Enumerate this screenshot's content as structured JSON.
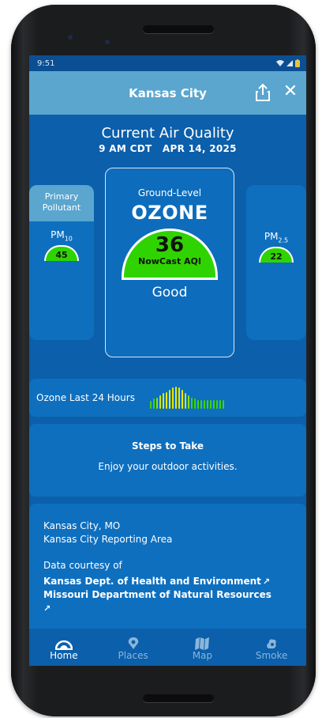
{
  "status": {
    "time": "9:51"
  },
  "appbar": {
    "title": "Kansas City"
  },
  "current": {
    "title": "Current Air Quality",
    "datetime": "9 AM CDT   APR 14, 2025"
  },
  "primary": {
    "header": "Primary Pollutant",
    "pollutant_main": "PM",
    "pollutant_sub": "10",
    "value": "45"
  },
  "main": {
    "label": "Ground-Level",
    "pollutant": "OZONE",
    "value": "36",
    "value_label": "NowCast AQI",
    "category": "Good",
    "color": "#2fd400"
  },
  "secondary": {
    "pollutant_main": "PM",
    "pollutant_sub": "2.5",
    "value": "22"
  },
  "trend": {
    "label": "Ozone Last 24 Hours",
    "levels": [
      0.35,
      0.45,
      0.5,
      0.6,
      0.7,
      0.75,
      0.85,
      0.95,
      1.0,
      0.95,
      0.85,
      0.7,
      0.6,
      0.5,
      0.45,
      0.4,
      0.4,
      0.4,
      0.4,
      0.4,
      0.4,
      0.4,
      0.4,
      0.4
    ],
    "colors": [
      "#3fd400",
      "#3fd400",
      "#8ee000",
      "#cbe800",
      "#e0e800",
      "#e8e800",
      "#e8e800",
      "#e8e800",
      "#e8e800",
      "#e8e800",
      "#e8e800",
      "#cbe800",
      "#8ee000",
      "#3fd400",
      "#3fd400",
      "#3fd400",
      "#3fd400",
      "#3fd400",
      "#3fd400",
      "#3fd400",
      "#3fd400",
      "#3fd400",
      "#3fd400",
      "#3fd400"
    ]
  },
  "steps": {
    "title": "Steps to Take",
    "text": "Enjoy your outdoor activities."
  },
  "info": {
    "location": "Kansas City, MO",
    "area": "Kansas City Reporting Area",
    "courtesy": "Data courtesy of",
    "source1": "Kansas Dept. of Health and Environment",
    "source2": "Missouri Department of Natural Resources"
  },
  "nav": [
    {
      "label": "Home",
      "icon": "gauge-icon"
    },
    {
      "label": "Places",
      "icon": "location-pin-icon"
    },
    {
      "label": "Map",
      "icon": "map-icon"
    },
    {
      "label": "Smoke",
      "icon": "smoke-icon"
    }
  ]
}
